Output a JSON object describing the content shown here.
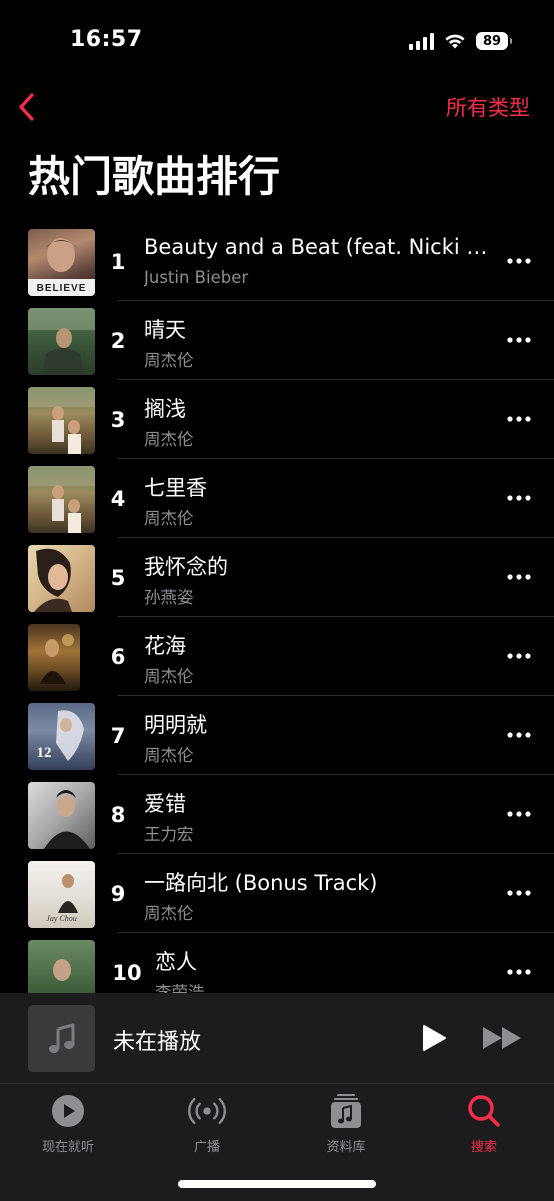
{
  "status_bar": {
    "time": "16:57",
    "battery": "89"
  },
  "nav": {
    "filter_label": "所有类型"
  },
  "page": {
    "title": "热门歌曲排行"
  },
  "songs": [
    {
      "rank": "1",
      "title": "Beauty and a Beat (feat. Nicki Minaj)",
      "artist": "Justin Bieber",
      "cover_text": "BELIEVE"
    },
    {
      "rank": "2",
      "title": "晴天",
      "artist": "周杰伦",
      "cover_text": ""
    },
    {
      "rank": "3",
      "title": "搁浅",
      "artist": "周杰伦",
      "cover_text": ""
    },
    {
      "rank": "4",
      "title": "七里香",
      "artist": "周杰伦",
      "cover_text": ""
    },
    {
      "rank": "5",
      "title": "我怀念的",
      "artist": "孙燕姿",
      "cover_text": ""
    },
    {
      "rank": "6",
      "title": "花海",
      "artist": "周杰伦",
      "cover_text": ""
    },
    {
      "rank": "7",
      "title": "明明就",
      "artist": "周杰伦",
      "cover_text": "12"
    },
    {
      "rank": "8",
      "title": "爱错",
      "artist": "王力宏",
      "cover_text": ""
    },
    {
      "rank": "9",
      "title": "一路向北 (Bonus Track)",
      "artist": "周杰伦",
      "cover_text": "Jay Chou"
    },
    {
      "rank": "10",
      "title": "恋人",
      "artist": "李荣浩",
      "cover_text": ""
    }
  ],
  "mini_player": {
    "title": "未在播放"
  },
  "tabs": [
    {
      "label": "现在就听",
      "icon": "play-circle-icon",
      "active": false
    },
    {
      "label": "广播",
      "icon": "radio-icon",
      "active": false
    },
    {
      "label": "资料库",
      "icon": "library-icon",
      "active": false
    },
    {
      "label": "搜索",
      "icon": "search-icon",
      "active": true
    }
  ],
  "colors": {
    "accent": "#fa2d48",
    "background": "#000000",
    "secondary_text": "#8e8e93",
    "player_bg": "#1c1c1e"
  }
}
